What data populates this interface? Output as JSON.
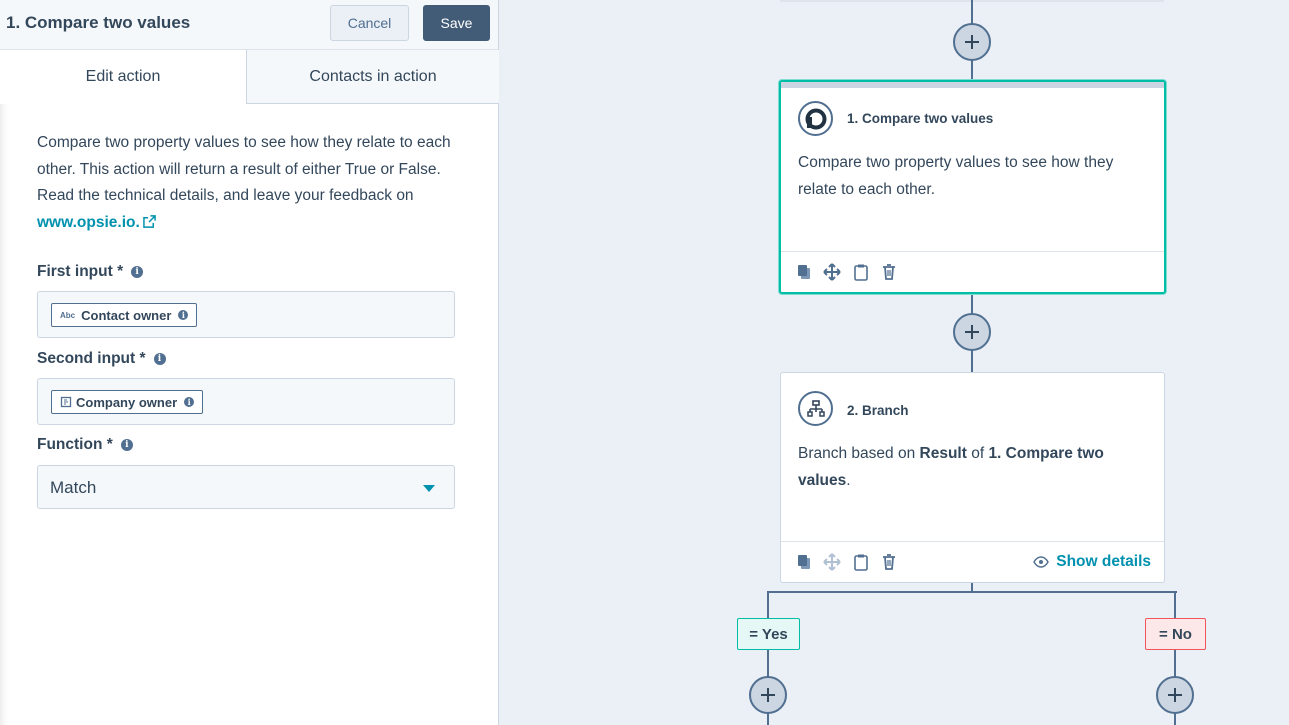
{
  "panel": {
    "title": "1. Compare two values",
    "cancel_label": "Cancel",
    "save_label": "Save",
    "tabs": [
      {
        "label": "Edit action",
        "active": true
      },
      {
        "label": "Contacts in action",
        "active": false
      }
    ],
    "description": "Compare two property values to see how they relate to each other. This action will return a result of either True or False. Read the technical details, and leave your feedback on ",
    "link_text": "www.opsie.io.",
    "fields": [
      {
        "label": "First input *",
        "token_prefix": "Abc",
        "token_label": "Contact owner",
        "token_icon": "text-property-icon"
      },
      {
        "label": "Second input *",
        "token_prefix": "",
        "token_label": "Company owner",
        "token_icon": "company-property-icon"
      }
    ],
    "function_label": "Function *",
    "function_value": "Match"
  },
  "canvas": {
    "card1": {
      "title": "1. Compare two values",
      "body": "Compare two property values to see how they relate to each other."
    },
    "card2": {
      "title": "2. Branch",
      "body_prefix": "Branch based on ",
      "body_bold1": "Result",
      "body_mid": " of ",
      "body_bold2": "1. Compare two values",
      "body_suffix": ".",
      "show_details": "Show details"
    },
    "branches": {
      "yes": "= Yes",
      "no": "= No"
    }
  },
  "colors": {
    "accent": "#0091ae",
    "selected_border": "#00bda5",
    "save_button": "#425b76",
    "yes_tag": "#e5f8f6",
    "no_tag": "#fde8e9"
  }
}
